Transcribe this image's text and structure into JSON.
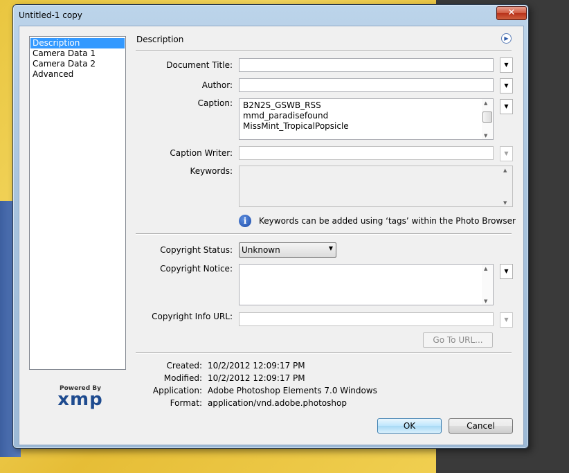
{
  "window": {
    "title": "Untitled-1 copy",
    "close_label": "✕"
  },
  "sidebar": {
    "items": [
      "Description",
      "Camera Data 1",
      "Camera Data 2",
      "Advanced"
    ]
  },
  "logo": {
    "powered": "Powered By",
    "name": "xmp"
  },
  "panel": {
    "title": "Description"
  },
  "fields": {
    "document_title": {
      "label": "Document Title:",
      "value": ""
    },
    "author": {
      "label": "Author:",
      "value": ""
    },
    "caption": {
      "label": "Caption:",
      "lines": [
        "B2N2S_GSWB_RSS",
        "mmd_paradisefound",
        "MissMint_TropicalPopsicle"
      ]
    },
    "caption_writer": {
      "label": "Caption Writer:",
      "value": ""
    },
    "keywords": {
      "label": "Keywords:",
      "value": ""
    },
    "keywords_info": "Keywords can be added using ‘tags’ within the Photo Browser",
    "copyright_status": {
      "label": "Copyright Status:",
      "value": "Unknown"
    },
    "copyright_notice": {
      "label": "Copyright Notice:",
      "value": ""
    },
    "copyright_url": {
      "label": "Copyright Info URL:",
      "value": ""
    },
    "goto_url": "Go To URL..."
  },
  "metadata": [
    {
      "label": "Created:",
      "value": "10/2/2012 12:09:17 PM"
    },
    {
      "label": "Modified:",
      "value": "10/2/2012 12:09:17 PM"
    },
    {
      "label": "Application:",
      "value": "Adobe Photoshop Elements 7.0 Windows"
    },
    {
      "label": "Format:",
      "value": "application/vnd.adobe.photoshop"
    }
  ],
  "buttons": {
    "ok": "OK",
    "cancel": "Cancel"
  }
}
